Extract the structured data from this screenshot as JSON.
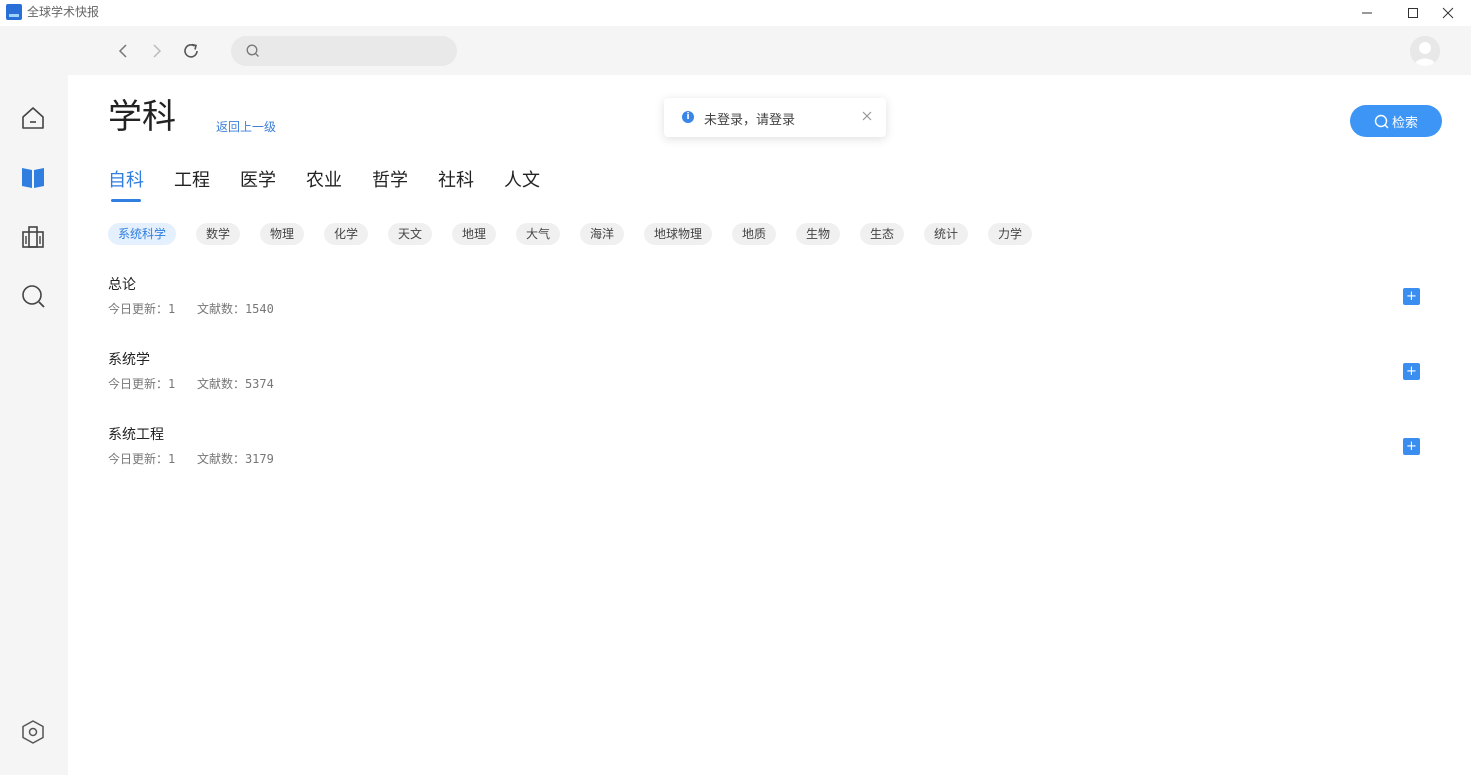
{
  "app": {
    "title": "全球学术快报"
  },
  "search": {
    "placeholder": ""
  },
  "page": {
    "title": "学科",
    "back_link": "返回上一级",
    "search_button": "检索"
  },
  "toast": {
    "message": "未登录，请登录"
  },
  "tabs": [
    {
      "label": "自科",
      "active": true
    },
    {
      "label": "工程"
    },
    {
      "label": "医学"
    },
    {
      "label": "农业"
    },
    {
      "label": "哲学"
    },
    {
      "label": "社科"
    },
    {
      "label": "人文"
    }
  ],
  "chips": [
    {
      "label": "系统科学",
      "active": true
    },
    {
      "label": "数学"
    },
    {
      "label": "物理"
    },
    {
      "label": "化学"
    },
    {
      "label": "天文"
    },
    {
      "label": "地理"
    },
    {
      "label": "大气"
    },
    {
      "label": "海洋"
    },
    {
      "label": "地球物理"
    },
    {
      "label": "地质"
    },
    {
      "label": "生物"
    },
    {
      "label": "生态"
    },
    {
      "label": "统计"
    },
    {
      "label": "力学"
    }
  ],
  "subjects": [
    {
      "name": "总论",
      "today_label": "今日更新：",
      "today": "1",
      "docs_label": "文献数：",
      "docs": "1540",
      "add": "+"
    },
    {
      "name": "系统学",
      "today_label": "今日更新：",
      "today": "1",
      "docs_label": "文献数：",
      "docs": "5374",
      "add": "+"
    },
    {
      "name": "系统工程",
      "today_label": "今日更新：",
      "today": "1",
      "docs_label": "文献数：",
      "docs": "3179",
      "add": "+"
    }
  ],
  "colors": {
    "accent": "#2f7ee0",
    "button": "#3d95f5",
    "sidebar_bg": "#f5f5f5"
  },
  "icons": {
    "sidebar": [
      "home-icon",
      "book-icon",
      "library-icon",
      "search-icon"
    ],
    "sidebar_bottom": "settings-hexagon-icon"
  }
}
